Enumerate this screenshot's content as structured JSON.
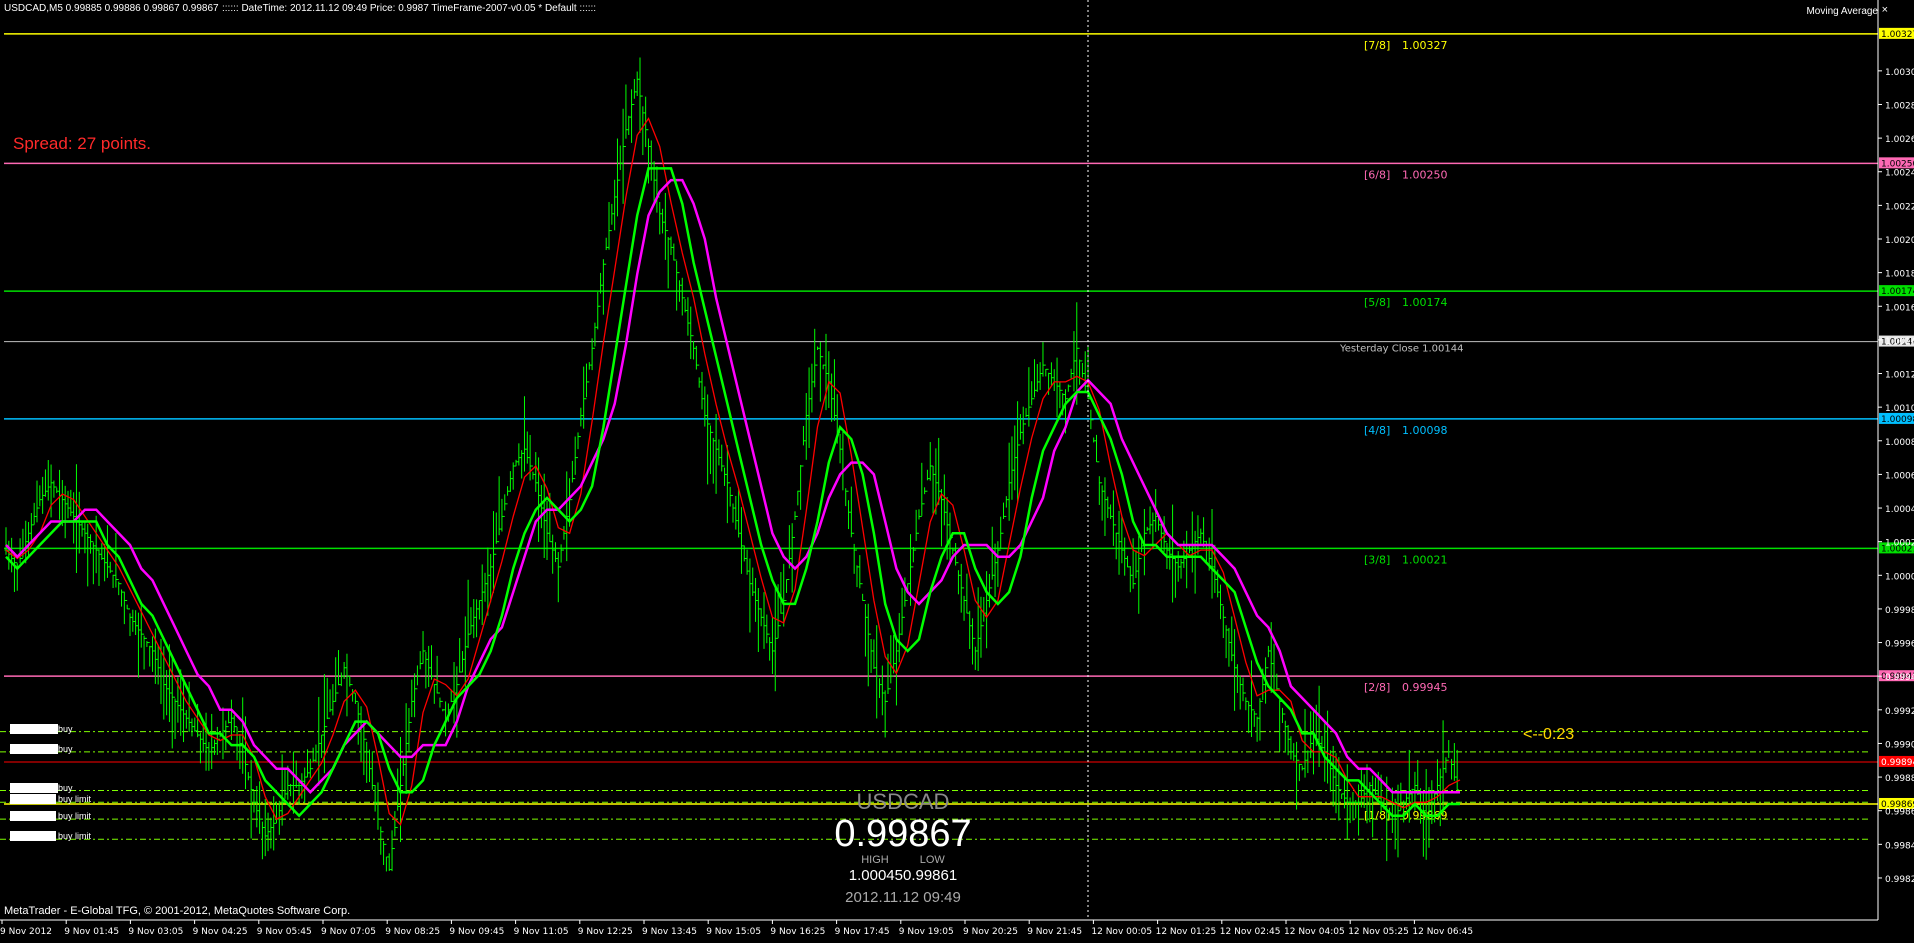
{
  "header": {
    "symbol_info": "USDCAD,M5  0.99885 0.99886 0.99867 0.99867",
    "info_line": ":::::: DateTime: 2012.11.12 09:49    Price: 0.9987    TimeFrame-2007-v0.05    *  Default   ::::::",
    "indicator_label": "Moving Average",
    "close_glyph": "×"
  },
  "spread_text": "Spread: 27 points.",
  "countdown_text": "<--0:23",
  "footer_text": "MetaTrader - E-Global TFG, © 2001-2012, MetaQuotes Software Corp.",
  "info_panel": {
    "symbol": "USDCAD",
    "price": "0.99867",
    "high_label": "HIGH",
    "low_label": "LOW",
    "high_low": "1.000450.99861",
    "time": "2012.11.12 09:49"
  },
  "orders": [
    {
      "label": "buy",
      "price": 0.99912
    },
    {
      "label": "buy",
      "price": 0.999
    },
    {
      "label": "buy",
      "price": 0.99877
    },
    {
      "label": "buy limit",
      "price": 0.9987
    },
    {
      "label": "buy limit",
      "price": 0.9986
    },
    {
      "label": "buy limit",
      "price": 0.99848
    }
  ],
  "colors": {
    "background": "#000000",
    "candles": "#00ff00",
    "ma_red": "#ff0000",
    "ma_magenta": "#ff00ff",
    "ma_green": "#00ff00",
    "yellow": "#ffff00",
    "pink": "#ff69b4",
    "light_green": "#00e000",
    "blue": "#00bfff",
    "grey": "#c0c0c0"
  },
  "chart_data": {
    "type": "line",
    "symbol": "USDCAD",
    "timeframe": "M5",
    "ylim": [
      0.998,
      1.0034
    ],
    "y_ticks": [
      "1.00305",
      "1.00285",
      "1.00265",
      "1.00245",
      "1.00225",
      "1.00205",
      "1.00185",
      "1.00165",
      "1.00145",
      "1.00125",
      "1.00105",
      "1.00085",
      "1.00065",
      "1.00045",
      "1.00025",
      "1.00005",
      "0.99985",
      "0.99965",
      "0.99945",
      "0.99925",
      "0.99905",
      "0.99885",
      "0.99865",
      "0.99845",
      "0.99825"
    ],
    "x_ticks": [
      "9 Nov 2012",
      "9 Nov 01:45",
      "9 Nov 03:05",
      "9 Nov 04:25",
      "9 Nov 05:45",
      "9 Nov 07:05",
      "9 Nov 08:25",
      "9 Nov 09:45",
      "9 Nov 11:05",
      "9 Nov 12:25",
      "9 Nov 13:45",
      "9 Nov 15:05",
      "9 Nov 16:25",
      "9 Nov 17:45",
      "9 Nov 19:05",
      "9 Nov 20:25",
      "9 Nov 21:45",
      "12 Nov 00:05",
      "12 Nov 01:25",
      "12 Nov 02:45",
      "12 Nov 04:05",
      "12 Nov 05:25",
      "12 Nov 06:45"
    ],
    "murrey_levels": [
      {
        "tag": "[7/8]",
        "value": "1.00327",
        "price": 1.00327,
        "color": "#ffff00",
        "axis_tag": "1.00327"
      },
      {
        "tag": "[6/8]",
        "value": "1.00250",
        "price": 1.0025,
        "color": "#ff69b4",
        "axis_tag": "1.00250"
      },
      {
        "tag": "[5/8]",
        "value": "1.00174",
        "price": 1.00174,
        "color": "#00e000",
        "axis_tag": "1.00174"
      },
      {
        "tag": "[4/8]",
        "value": "1.00098",
        "price": 1.00098,
        "color": "#00bfff",
        "axis_tag": "1.00098"
      },
      {
        "tag": "[3/8]",
        "value": "1.00021",
        "price": 1.00021,
        "color": "#00e000",
        "axis_tag": "1.00021"
      },
      {
        "tag": "[2/8]",
        "value": "0.99945",
        "price": 0.99945,
        "color": "#ff69b4",
        "axis_tag": "0.99945"
      },
      {
        "tag": "[1/8]",
        "value": "0.99869",
        "price": 0.99869,
        "color": "#ffff00",
        "axis_tag": "0.99869"
      }
    ],
    "yesterday_close": {
      "label": "Yesterday Close 1.00144",
      "price": 1.00144,
      "axis_tag": "1.00144"
    },
    "current_price": {
      "price": 0.99894,
      "axis_tag": "0.99894"
    },
    "close_series": [
      1.0002,
      1.0001,
      1.0003,
      1.0005,
      1.0006,
      1.0005,
      1.0004,
      1.0003,
      1.0002,
      1.0001,
      1.0,
      0.9998,
      0.9997,
      0.9996,
      0.9994,
      0.9993,
      0.9992,
      0.9991,
      0.999,
      0.9991,
      0.9992,
      0.999,
      0.9987,
      0.9985,
      0.9986,
      0.9988,
      0.9988,
      0.9989,
      0.9991,
      0.9993,
      0.9995,
      0.9993,
      0.999,
      0.9986,
      0.9983,
      0.9988,
      0.9993,
      0.9996,
      0.9994,
      0.9992,
      0.9994,
      0.9997,
      0.9999,
      1.0001,
      1.0004,
      1.0007,
      1.0008,
      1.0006,
      1.0003,
      1.0001,
      1.0005,
      1.001,
      1.0014,
      1.0019,
      1.0023,
      1.0027,
      1.003,
      1.0026,
      1.0022,
      1.002,
      1.0017,
      1.0014,
      1.001,
      1.0008,
      1.0006,
      1.0003,
      1.0,
      0.9998,
      0.9996,
      0.9999,
      1.0004,
      1.001,
      1.0014,
      1.0012,
      1.0008,
      1.0003,
      0.9999,
      0.9995,
      0.9993,
      0.9996,
      1.0,
      1.0004,
      1.0007,
      1.0005,
      1.0002,
      0.9999,
      0.9996,
      0.9999,
      1.0002,
      1.0006,
      1.0009,
      1.0011,
      1.0013,
      1.0012,
      1.0011,
      1.0014,
      1.0011,
      1.0006,
      1.0004,
      1.0002,
      1.0,
      1.0003,
      1.0004,
      1.0002,
      1.0001,
      1.0002,
      1.0003,
      1.0001,
      0.9998,
      0.9995,
      0.9993,
      0.9992,
      0.9996,
      0.9993,
      0.999,
      0.9989,
      0.9991,
      0.999,
      0.9988,
      0.9987,
      0.9987,
      0.9988,
      0.9987,
      0.9986,
      0.9987,
      0.9988,
      0.9986,
      0.9988,
      0.999,
      0.9987
    ]
  }
}
